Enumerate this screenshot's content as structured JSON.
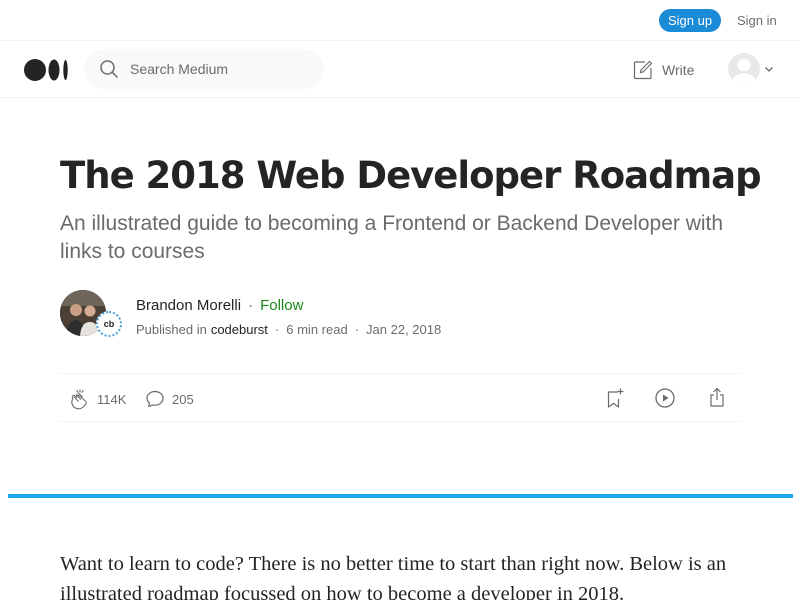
{
  "topbar": {
    "signup_label": "Sign up",
    "signin_label": "Sign in"
  },
  "header": {
    "logo": "medium-logo",
    "search": {
      "placeholder": "Search Medium",
      "value": ""
    },
    "write_label": "Write"
  },
  "article": {
    "title": "The 2018 Web Developer Roadmap",
    "subtitle": "An illustrated guide to becoming a Frontend or Backend Developer with links to courses",
    "author": {
      "name": "Brandon Morelli",
      "follow_label": "Follow",
      "dot": "·"
    },
    "publication": {
      "badge": "cb",
      "prefix": "Published in",
      "name": "codeburst"
    },
    "read_time": "6 min read",
    "date": "Jan 22, 2018",
    "claps": "114K",
    "responses": "205",
    "body": "Want to learn to code? There is no better time to start than right now. Below is an illustrated roadmap focussed on how to become a developer in 2018."
  },
  "colors": {
    "accent": "#1a8bd6",
    "follow": "#1a8917",
    "hero": "#1ba8ee"
  }
}
